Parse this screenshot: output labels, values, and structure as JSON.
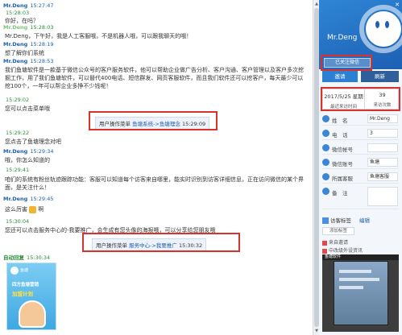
{
  "chat": {
    "messages": [
      {
        "name": "Mr.Deng",
        "time": "15:27:47",
        "role": "staff",
        "text": ""
      },
      {
        "name": "",
        "time": "15:28:03",
        "role": "visitor",
        "text": "你好，在吗？"
      },
      {
        "name": "Mr.Deng",
        "time": "15:28:03",
        "role": "staff",
        "text": "Mr.Deng，下午好，我是人工客服哦，不是机器人哦，可以跟我聊天的哦！"
      },
      {
        "name": "Mr.Deng",
        "time": "15:28:19",
        "role": "staff",
        "text": "想了解你们系统"
      },
      {
        "name": "Mr.Deng",
        "time": "15:28:53",
        "role": "staff",
        "text": "我们鱼塘软件是一款基于微信公众号的客户服务软件，他可以帮助企业做广告分析、客户沟通、客户管理以及客户多次挖掘工作，用了我们鱼塘软件，可以替代400电话、短信群发、网页客服软件，而且我们软件还可以挖客户，每天最少可以挖100个，一年可以帮企业多挣不少钱呢！"
      },
      {
        "name": "",
        "time": "15:29:02",
        "role": "visitor",
        "text": "您可以点击菜单哦"
      },
      {
        "name": "",
        "time": "15:29:22",
        "role": "visitor",
        "text": "您点击了鱼塘理念对吧"
      },
      {
        "name": "Mr.Deng",
        "time": "15:29:34",
        "role": "staff",
        "text": "哦，你怎么知道的"
      },
      {
        "name": "",
        "time": "15:29:41",
        "role": "visitor",
        "text": "咱们的系统有粉丝轨迹跟踪功能：客服可以知道每个访客来自哪里，能实时识别到访客详细信息，正在访问微信的某个界面，是关注什么！"
      },
      {
        "name": "Mr.Deng",
        "time": "15:29:45",
        "role": "staff",
        "text": "这么厉害"
      },
      {
        "name": "",
        "time": "15:30:04",
        "role": "visitor",
        "text": "您还可以点击服务中心的-我要推广，会生成有您头像的海报哦，可以分享给您朋友哦"
      },
      {
        "name": "自动回复",
        "time": "15:30:34",
        "role": "auto",
        "text": ""
      }
    ],
    "emoji_suffix": "啊",
    "events": [
      {
        "label": "用户操作菜单",
        "path": "鱼塘系统->鱼塘理念",
        "time": "15:29:09"
      },
      {
        "label": "用户操作菜单",
        "path": "服务中心->我要推广",
        "time": "15:30:32"
      }
    ],
    "card": {
      "brand": "鱼塘",
      "line1": "四方鱼塘营销",
      "line2": "加盟计划"
    }
  },
  "panel": {
    "banner_title": "Mr.Deng",
    "subscribe_btn": "已关注微信",
    "invite_btn": "邀请",
    "refresh_btn": "刷新",
    "stats": {
      "last_visit_value": "2017/5/25 星期",
      "last_visit_label": "最近来访时间",
      "visits_value": "39",
      "visits_label": "来访次数"
    },
    "fields": [
      {
        "key": "姓　名",
        "value": "Mr.Deng"
      },
      {
        "key": "电　话",
        "value": "3"
      },
      {
        "key": "微信帐号",
        "value": ""
      },
      {
        "key": "微信账号",
        "value": "鱼塘"
      },
      {
        "key": "所属客服",
        "value": "鱼塘客服"
      },
      {
        "key": "备　注",
        "value": ""
      }
    ],
    "tag_label": "访客标签",
    "tag_edit": "编辑",
    "tag_btn": "添加标签",
    "referrals": [
      {
        "text": "来自邀请"
      },
      {
        "text": "中改级外设资讯"
      }
    ],
    "video_label": "鱼塘软件"
  }
}
